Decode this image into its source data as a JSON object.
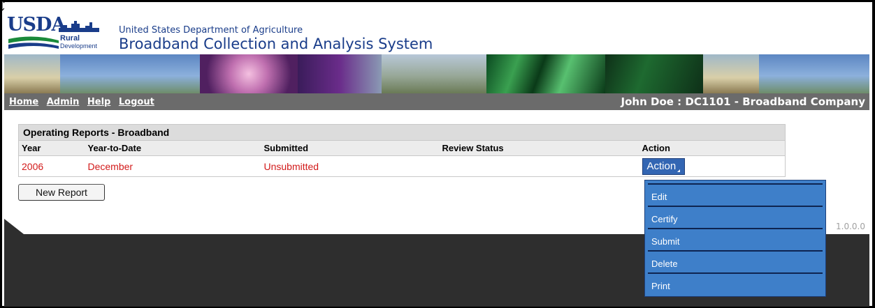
{
  "header": {
    "logo_text": "USDA",
    "logo_sub1": "Rural",
    "logo_sub2": "Development",
    "department": "United States Department of Agriculture",
    "system_name": "Broadband Collection and Analysis System"
  },
  "nav": {
    "links": [
      "Home",
      "Admin",
      "Help",
      "Logout"
    ],
    "user_info": "John Doe : DC1101 - Broadband Company"
  },
  "report": {
    "title": "Operating Reports - Broadband",
    "columns": [
      "Year",
      "Year-to-Date",
      "Submitted",
      "Review Status",
      "Action"
    ],
    "rows": [
      {
        "year": "2006",
        "ytd": "December",
        "submitted": "Unsubmitted",
        "review_status": "",
        "action_label": "Action"
      }
    ],
    "new_report_label": "New Report"
  },
  "action_menu": {
    "items": [
      "Edit",
      "Certify",
      "Submit",
      "Delete",
      "Print"
    ]
  },
  "footer": {
    "version": "1.0.0.0"
  },
  "colors": {
    "brand_blue": "#1a3d8a",
    "nav_gray": "#6b6b6b",
    "row_red": "#d21a1a",
    "menu_blue": "#3e7fc9"
  }
}
